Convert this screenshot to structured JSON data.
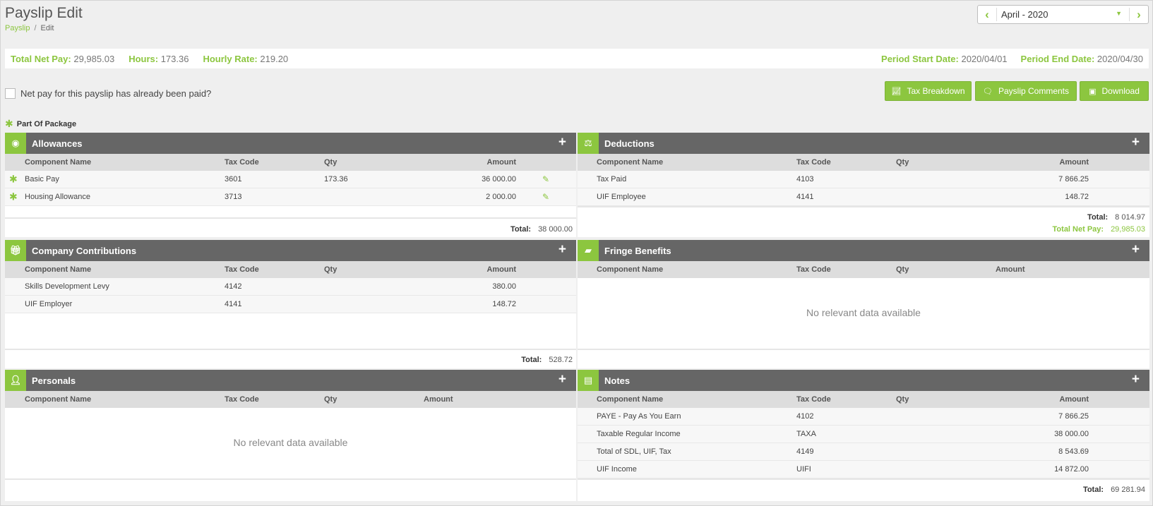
{
  "page": {
    "title": "Payslip Edit",
    "breadcrumb": [
      "Payslip",
      "Edit"
    ]
  },
  "period": {
    "value": "April - 2020"
  },
  "summary": {
    "net_pay_label": "Total Net Pay:",
    "net_pay": "29,985.03",
    "hours_label": "Hours:",
    "hours": "173.36",
    "rate_label": "Hourly Rate:",
    "rate": "219.20",
    "start_label": "Period Start Date:",
    "start": "2020/04/01",
    "end_label": "Period End Date:",
    "end": "2020/04/30"
  },
  "paid_question": "Net pay for this payslip has already been paid?",
  "actions": {
    "tax": "Tax Breakdown",
    "comments": "Payslip Comments",
    "download": "Download"
  },
  "legend": "Part Of Package",
  "cols": {
    "name": "Component Name",
    "tax": "Tax Code",
    "qty": "Qty",
    "amount": "Amount"
  },
  "no_data": "No relevant data available",
  "total_label": "Total:",
  "allowances": {
    "title": "Allowances",
    "rows": [
      {
        "name": "Basic Pay",
        "tax": "3601",
        "qty": "173.36",
        "amount": "36 000.00"
      },
      {
        "name": "Housing Allowance",
        "tax": "3713",
        "qty": "",
        "amount": "2 000.00"
      }
    ],
    "total": "38 000.00"
  },
  "deductions": {
    "title": "Deductions",
    "rows": [
      {
        "name": "Tax Paid",
        "tax": "4103",
        "qty": "",
        "amount": "7 866.25"
      },
      {
        "name": "UIF Employee",
        "tax": "4141",
        "qty": "",
        "amount": "148.72"
      }
    ],
    "total": "8 014.97",
    "net_label": "Total Net Pay:",
    "net": "29,985.03"
  },
  "contributions": {
    "title": "Company Contributions",
    "rows": [
      {
        "name": "Skills Development Levy",
        "tax": "4142",
        "qty": "",
        "amount": "380.00"
      },
      {
        "name": "UIF Employer",
        "tax": "4141",
        "qty": "",
        "amount": "148.72"
      }
    ],
    "total": "528.72"
  },
  "fringe": {
    "title": "Fringe Benefits"
  },
  "personals": {
    "title": "Personals"
  },
  "notes": {
    "title": "Notes",
    "rows": [
      {
        "name": "PAYE - Pay As You Earn",
        "tax": "4102",
        "qty": "",
        "amount": "7 866.25"
      },
      {
        "name": "Taxable Regular Income",
        "tax": "TAXA",
        "qty": "",
        "amount": "38 000.00"
      },
      {
        "name": "Total of SDL, UIF, Tax",
        "tax": "4149",
        "qty": "",
        "amount": "8 543.69"
      },
      {
        "name": "UIF Income",
        "tax": "UIFI",
        "qty": "",
        "amount": "14 872.00"
      }
    ],
    "total": "69 281.94"
  },
  "colors": {
    "accent": "#8cc63f",
    "header": "#666666"
  },
  "icons": {
    "prev": "chevron-left-icon",
    "next": "chevron-right-icon",
    "add": "plus-icon",
    "edit": "pencil-icon",
    "star": "asterisk-icon"
  }
}
